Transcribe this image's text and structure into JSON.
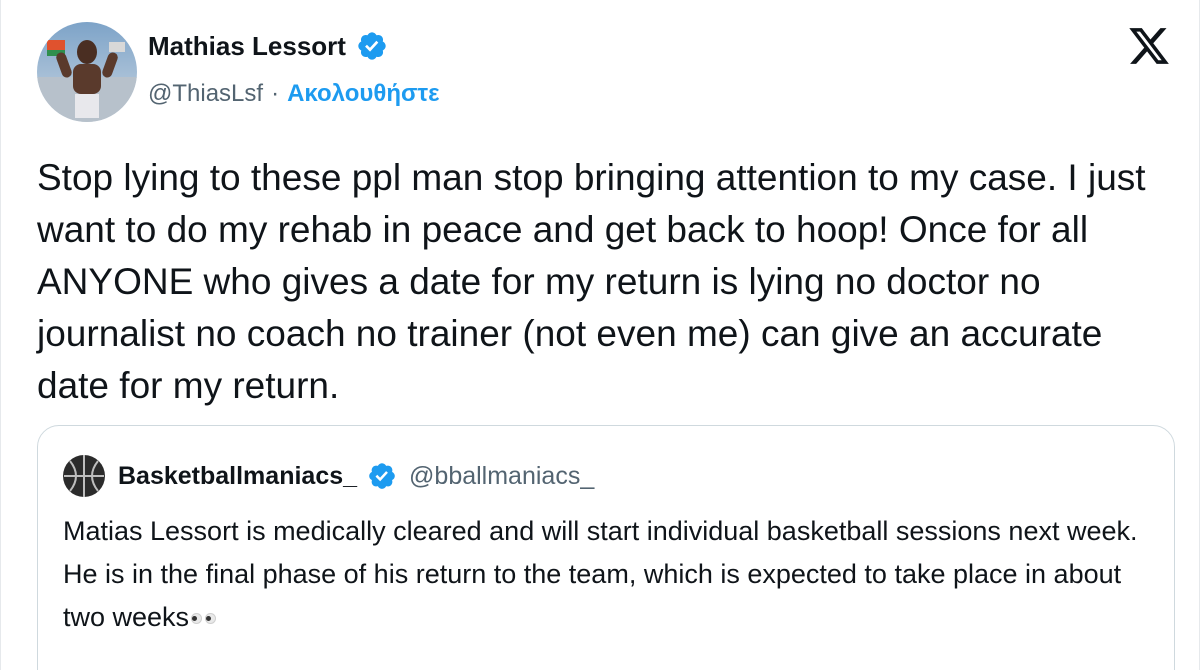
{
  "tweet": {
    "author": {
      "name": "Mathias Lessort",
      "handle": "@ThiasLsf",
      "follow_label": "Ακολουθήστε",
      "separator": "·"
    },
    "text": "Stop lying to these ppl man stop bringing attention to my case. I just want to do my rehab in peace and get back to hoop! Once for all ANYONE who gives a date for my return is lying no doctor no journalist no coach no trainer (not even me) can give an accurate date for my return."
  },
  "quoted_tweet": {
    "author": {
      "name": "Basketballmaniacs_",
      "handle": "@bballmaniacs_"
    },
    "text": "Matias Lessort is medically cleared and will start individual basketball sessions next week. He is in the final phase of his return to the team, which is expected to take place in about two weeks",
    "emoji": "eyes"
  },
  "icons": {
    "verified": "verified-badge-icon",
    "platform": "x-logo-icon"
  },
  "colors": {
    "accent": "#1d9bf0",
    "text": "#0f1419",
    "secondary": "#536471",
    "border": "#cfd9de"
  }
}
